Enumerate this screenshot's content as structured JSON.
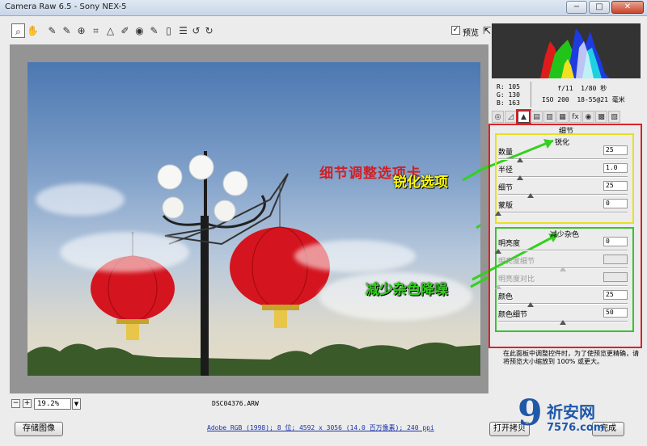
{
  "window": {
    "title": "Camera Raw 6.5 -  Sony NEX-5",
    "min_glyph": "−",
    "max_glyph": "□",
    "close_glyph": "✕"
  },
  "toolbar": {
    "tools": [
      "zoom-icon",
      "hand-icon",
      "white-balance-icon",
      "color-sampler-icon",
      "target-adjust-icon",
      "crop-icon",
      "straighten-icon",
      "spot-removal-icon",
      "red-eye-icon",
      "adjustment-brush-icon",
      "graduated-filter-icon",
      "preferences-icon",
      "rotate-left-icon",
      "rotate-right-icon"
    ],
    "tool_glyphs": [
      "⌕",
      "✋",
      "✎",
      "✎",
      "⊕",
      "⌗",
      "△",
      "✐",
      "◉",
      "✎",
      "▯",
      "☰",
      "↺",
      "↻"
    ],
    "preview_label": "预览",
    "preview_checked": "✓",
    "fullscreen_glyph": "⇱"
  },
  "annotations": {
    "detail_tab_caption": "细节调整选项卡",
    "sharpen_callout": "锐化选项",
    "noise_callout": "减少杂色降噪"
  },
  "status": {
    "zoom_out": "−",
    "zoom_in": "+",
    "zoom_value": "19.2%",
    "zoom_arrow": "▼",
    "filename": "DSC04376.ARW"
  },
  "bottom": {
    "save_button": "存储图像",
    "workflow_link": "Adobe RGB (1998); 8 位; 4592 x 3056 (14.0 百万像素); 240 ppi",
    "open_copy_button": "打开拷贝",
    "done_button": "完成"
  },
  "info": {
    "r_label": "R:",
    "r_value": "105",
    "g_label": "G:",
    "g_value": "130",
    "b_label": "B:",
    "b_value": "163",
    "aperture": "f/11",
    "shutter": "1/80 秒",
    "iso": "ISO 200",
    "lens": "18-55@21 毫米"
  },
  "panel": {
    "title": "细节",
    "tabs": [
      "basic-icon",
      "tone-curve-icon",
      "detail-icon",
      "hsl-icon",
      "split-toning-icon",
      "lens-icon",
      "fx-icon",
      "camera-calibration-icon",
      "presets-icon",
      "snapshots-icon"
    ],
    "tab_glyphs": [
      "◎",
      "◿",
      "▲",
      "▤",
      "▥",
      "▦",
      "fx",
      "◉",
      "▩",
      "▧"
    ],
    "sharpen": {
      "heading": "锐化",
      "rows": [
        {
          "label": "数量",
          "value": "25",
          "level": 0.17
        },
        {
          "label": "半径",
          "value": "1.0",
          "level": 0.17
        },
        {
          "label": "细节",
          "value": "25",
          "level": 0.25
        },
        {
          "label": "蒙版",
          "value": "0",
          "level": 0.0
        }
      ]
    },
    "noise": {
      "heading": "减少杂色",
      "rows": [
        {
          "label": "明亮度",
          "value": "0",
          "level": 0.0,
          "enabled": true
        },
        {
          "label": "明亮度细节",
          "value": "",
          "level": 0.5,
          "enabled": false
        },
        {
          "label": "明亮度对比",
          "value": "",
          "level": 0.0,
          "enabled": false
        },
        {
          "label": "颜色",
          "value": "25",
          "level": 0.25,
          "enabled": true
        },
        {
          "label": "颜色细节",
          "value": "50",
          "level": 0.5,
          "enabled": true
        }
      ]
    },
    "hint": "在此面板中调整控件时，为了使预览更精确，请将预览大小缩放到 100% 或更大。"
  },
  "watermark": {
    "digit": "9",
    "brand": "祈安网",
    "url": "7576.com"
  },
  "colors": {
    "annotation_red": "#d02025",
    "sharpen_box": "#e8e020",
    "noise_box": "#3ac22c",
    "panel_box": "#d8242a"
  }
}
